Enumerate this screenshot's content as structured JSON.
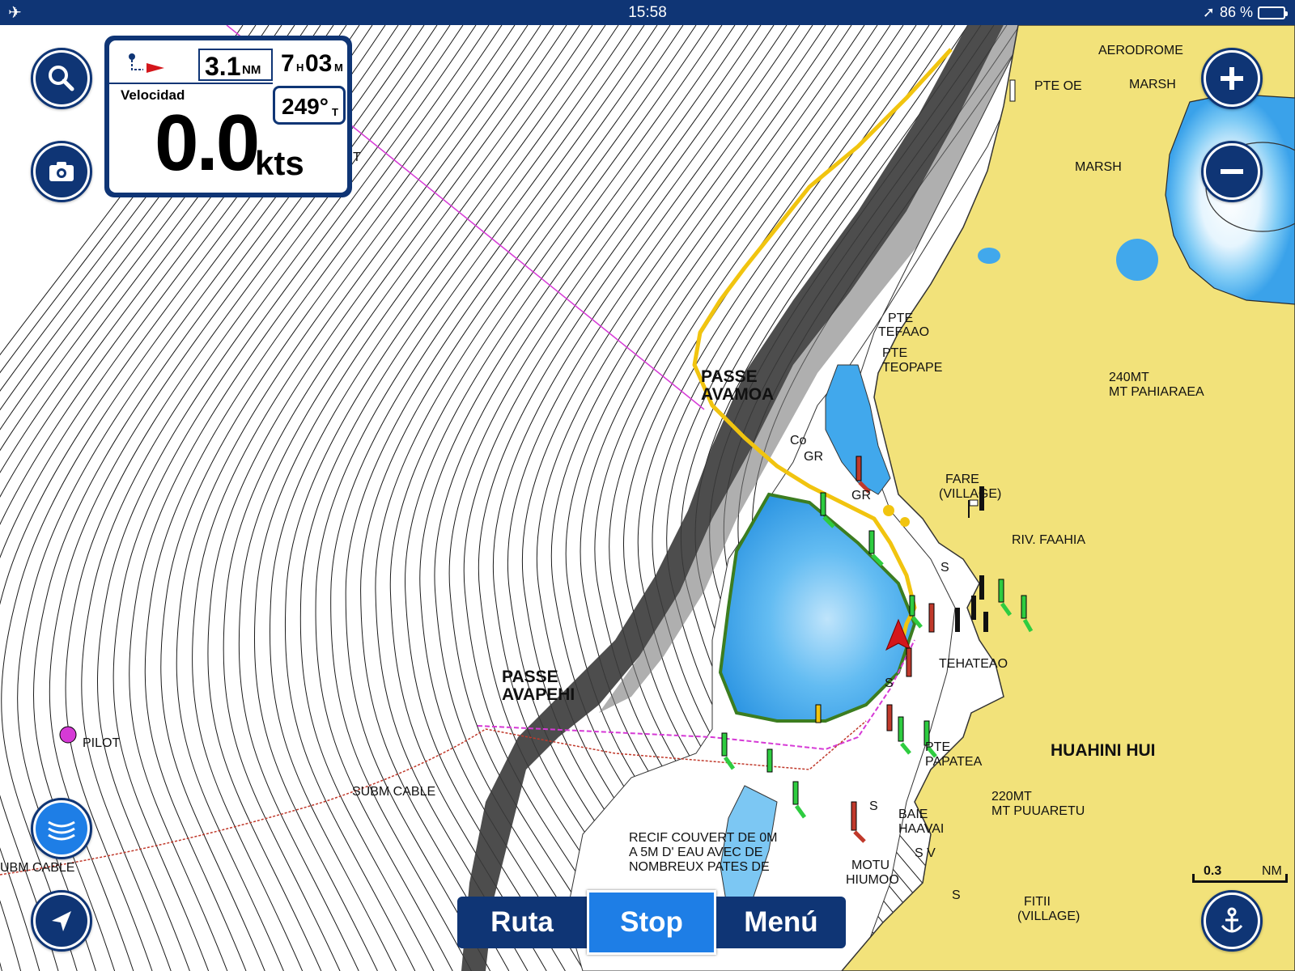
{
  "status_bar": {
    "time": "15:58",
    "battery": "86 %",
    "battery_level": 0.86
  },
  "nav_panel": {
    "distance": "3.1",
    "distance_unit": "NM",
    "time_hours": "7",
    "time_hours_unit": "H",
    "time_minutes": "03",
    "time_minutes_unit": "M",
    "speed_label": "Velocidad",
    "speed_value": "0.0",
    "speed_unit": "kts",
    "heading_value": "249°",
    "heading_unit": "T"
  },
  "map_labels": {
    "aerodrome": "AERODROME",
    "pte_oe": "PTE OE",
    "marsh_1": "MARSH",
    "marsh_2": "MARSH",
    "pte_tefaao_1": "PTE",
    "pte_tefaao_2": "TEFAAO",
    "pte_teopape_1": "PTE",
    "pte_teopape_2": "TEOPAPE",
    "mt_pahiaraea_1": "240MT",
    "mt_pahiaraea_2": "MT PAHIARAEA",
    "passe_avamoa_1": "PASSE",
    "passe_avamoa_2": "AVAMOA",
    "co": "Co",
    "gr_1": "GR",
    "gr_2": "GR",
    "fare_1": "FARE",
    "fare_2": "(VILLAGE)",
    "riv_faahia": "RIV. FAAHIA",
    "tehateao": "TEHATEAO",
    "passe_avapehi_1": "PASSE",
    "passe_avapehi_2": "AVAPEHI",
    "pilot": "PILOT",
    "subm_cable_1": "SUBM CABLE",
    "subm_cable_2": "UBM CABLE",
    "pte_papatea_1": "PTE",
    "pte_papatea_2": "PAPATEA",
    "huahini_hui": "HUAHINI HUI",
    "mt_puuaretu_1": "220MT",
    "mt_puuaretu_2": "MT PUUARETU",
    "baie_haavai_1": "BAIE",
    "baie_haavai_2": "HAAVAI",
    "recif_1": "RECIF COUVERT DE 0M",
    "recif_2": "A 5M D' EAU AVEC DE",
    "recif_3": "NOMBREUX PATES DE",
    "sv": "S V",
    "motu_1": "MOTU",
    "motu_2": "HIUMOO",
    "fitii_1": "FITII",
    "fitii_2": "(VILLAGE)",
    "s_1": "S",
    "s_2": "S",
    "s_3": "S",
    "s_4": "S",
    "t_mark": "T"
  },
  "scale": {
    "value": "0.3",
    "unit": "NM"
  },
  "bottom_bar": {
    "route": "Ruta",
    "stop": "Stop",
    "menu": "Menú"
  },
  "colors": {
    "ui_navy": "#0f3575",
    "active_blue": "#1e7ee6",
    "land": "#f2e27a",
    "shallow_water": "#41a8ec",
    "track": "#f1c40f",
    "boat": "#d4161b",
    "route_line": "#d63ad6",
    "cable": "#c0392b"
  },
  "icons": {
    "search": "search-icon",
    "camera": "camera-icon",
    "zoom_in": "plus-icon",
    "zoom_out": "minus-icon",
    "sonar": "sonar-icon",
    "locate": "location-arrow-icon",
    "anchor": "anchor-icon",
    "waypoint": "waypoint-flag-icon"
  }
}
